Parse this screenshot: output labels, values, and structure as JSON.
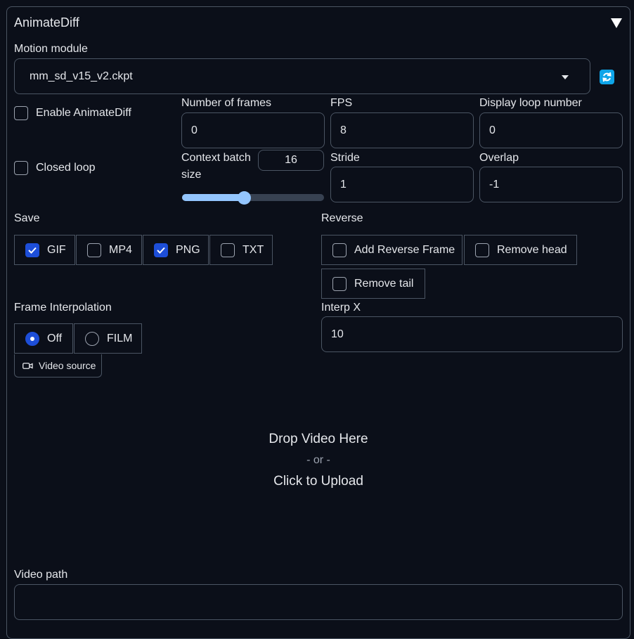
{
  "panel": {
    "title": "AnimateDiff"
  },
  "motion_module": {
    "label": "Motion module",
    "value": "mm_sd_v15_v2.ckpt"
  },
  "enable": {
    "label": "Enable AnimateDiff",
    "checked": false
  },
  "closed_loop": {
    "label": "Closed loop",
    "checked": false
  },
  "fields": {
    "frames": {
      "label": "Number of frames",
      "value": "0"
    },
    "fps": {
      "label": "FPS",
      "value": "8"
    },
    "display_loop": {
      "label": "Display loop number",
      "value": "0"
    },
    "context_batch": {
      "label_line1": "Context batch",
      "label_line2": "size",
      "value": "16",
      "slider_fraction": 0.44
    },
    "stride": {
      "label": "Stride",
      "value": "1"
    },
    "overlap": {
      "label": "Overlap",
      "value": "-1"
    },
    "interp_x": {
      "label": "Interp X",
      "value": "10"
    }
  },
  "save": {
    "label": "Save",
    "options": [
      {
        "label": "GIF",
        "checked": true
      },
      {
        "label": "MP4",
        "checked": false
      },
      {
        "label": "PNG",
        "checked": true
      },
      {
        "label": "TXT",
        "checked": false
      }
    ]
  },
  "reverse": {
    "label": "Reverse",
    "options": [
      {
        "label": "Add Reverse Frame",
        "checked": false
      },
      {
        "label": "Remove head",
        "checked": false
      },
      {
        "label": "Remove tail",
        "checked": false
      }
    ]
  },
  "frame_interpolation": {
    "label": "Frame Interpolation",
    "options": [
      {
        "label": "Off",
        "selected": true
      },
      {
        "label": "FILM",
        "selected": false
      }
    ]
  },
  "video": {
    "tab_label": "Video source",
    "drop_text": "Drop Video Here",
    "or_text": "- or -",
    "upload_text": "Click to Upload",
    "path_label": "Video path",
    "path_value": ""
  },
  "colors": {
    "accent": "#1d4ed8",
    "slider": "#93c5fd",
    "refresh": "#0ea5e9",
    "background": "#0b0f19"
  },
  "icons": {
    "collapse": "triangle-down-icon",
    "refresh": "refresh-icon",
    "video": "video-camera-icon",
    "dropdown": "chevron-down-icon"
  }
}
